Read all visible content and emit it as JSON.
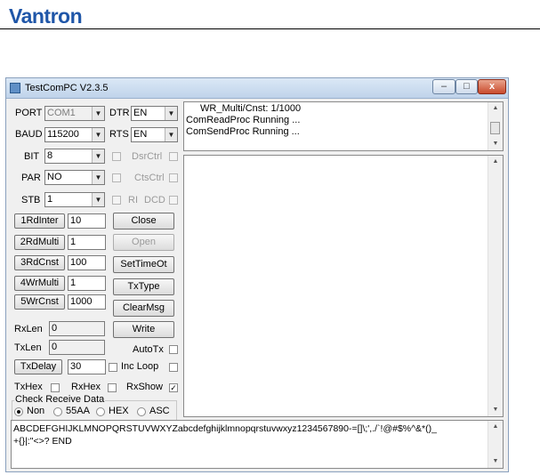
{
  "logo": "Vantron",
  "window": {
    "title": "TestComPC V2.3.5",
    "min_label": "–",
    "max_label": "□",
    "close_label": "x"
  },
  "port": {
    "label": "PORT",
    "value": "COM1"
  },
  "baud": {
    "label": "BAUD",
    "value": "115200"
  },
  "bit": {
    "label": "BIT",
    "value": "8"
  },
  "par": {
    "label": "PAR",
    "value": "NO"
  },
  "stb": {
    "label": "STB",
    "value": "1"
  },
  "dtr": {
    "label": "DTR",
    "value": "EN"
  },
  "rts": {
    "label": "RTS",
    "value": "EN"
  },
  "checks": {
    "dsrctrl": "DsrCtrl",
    "ctsctrl": "CtsCtrl",
    "ri": "RI",
    "dcd": "DCD"
  },
  "rows": [
    {
      "button": "1RdInter",
      "value": "10"
    },
    {
      "button": "2RdMulti",
      "value": "1"
    },
    {
      "button": "3RdCnst",
      "value": "100"
    },
    {
      "button": "4WrMulti",
      "value": "1"
    },
    {
      "button": "5WrCnst",
      "value": "1000"
    }
  ],
  "right_buttons": {
    "close": "Close",
    "open": "Open",
    "settimeout": "SetTimeOt",
    "txtype": "TxType",
    "clearmsg": "ClearMsg",
    "write": "Write"
  },
  "rxlen": {
    "label": "RxLen",
    "value": "0"
  },
  "txlen": {
    "label": "TxLen",
    "value": "0"
  },
  "autotx": "AutoTx",
  "txdelay": {
    "button": "TxDelay",
    "value": "30"
  },
  "incloop": "Inc  Loop",
  "txhex": "TxHex",
  "rxhex": "RxHex",
  "rxshow": "RxShow",
  "check_group": {
    "label": "Check Receive Data",
    "options": [
      "Non",
      "55AA",
      "HEX",
      "ASC"
    ],
    "selected": "Non"
  },
  "status_lines": [
    "WR_Multi/Cnst:   1/1000",
    "ComReadProc Running ...",
    "ComSendProc Running ..."
  ],
  "send_text_1": "ABCDEFGHIJKLMNOPQRSTUVWXYZabcdefghijklmnopqrstuvwxyz1234567890-=[]\\;',./`!@#$%^&*()_",
  "send_text_2": "+{}|:\"<>?  END"
}
